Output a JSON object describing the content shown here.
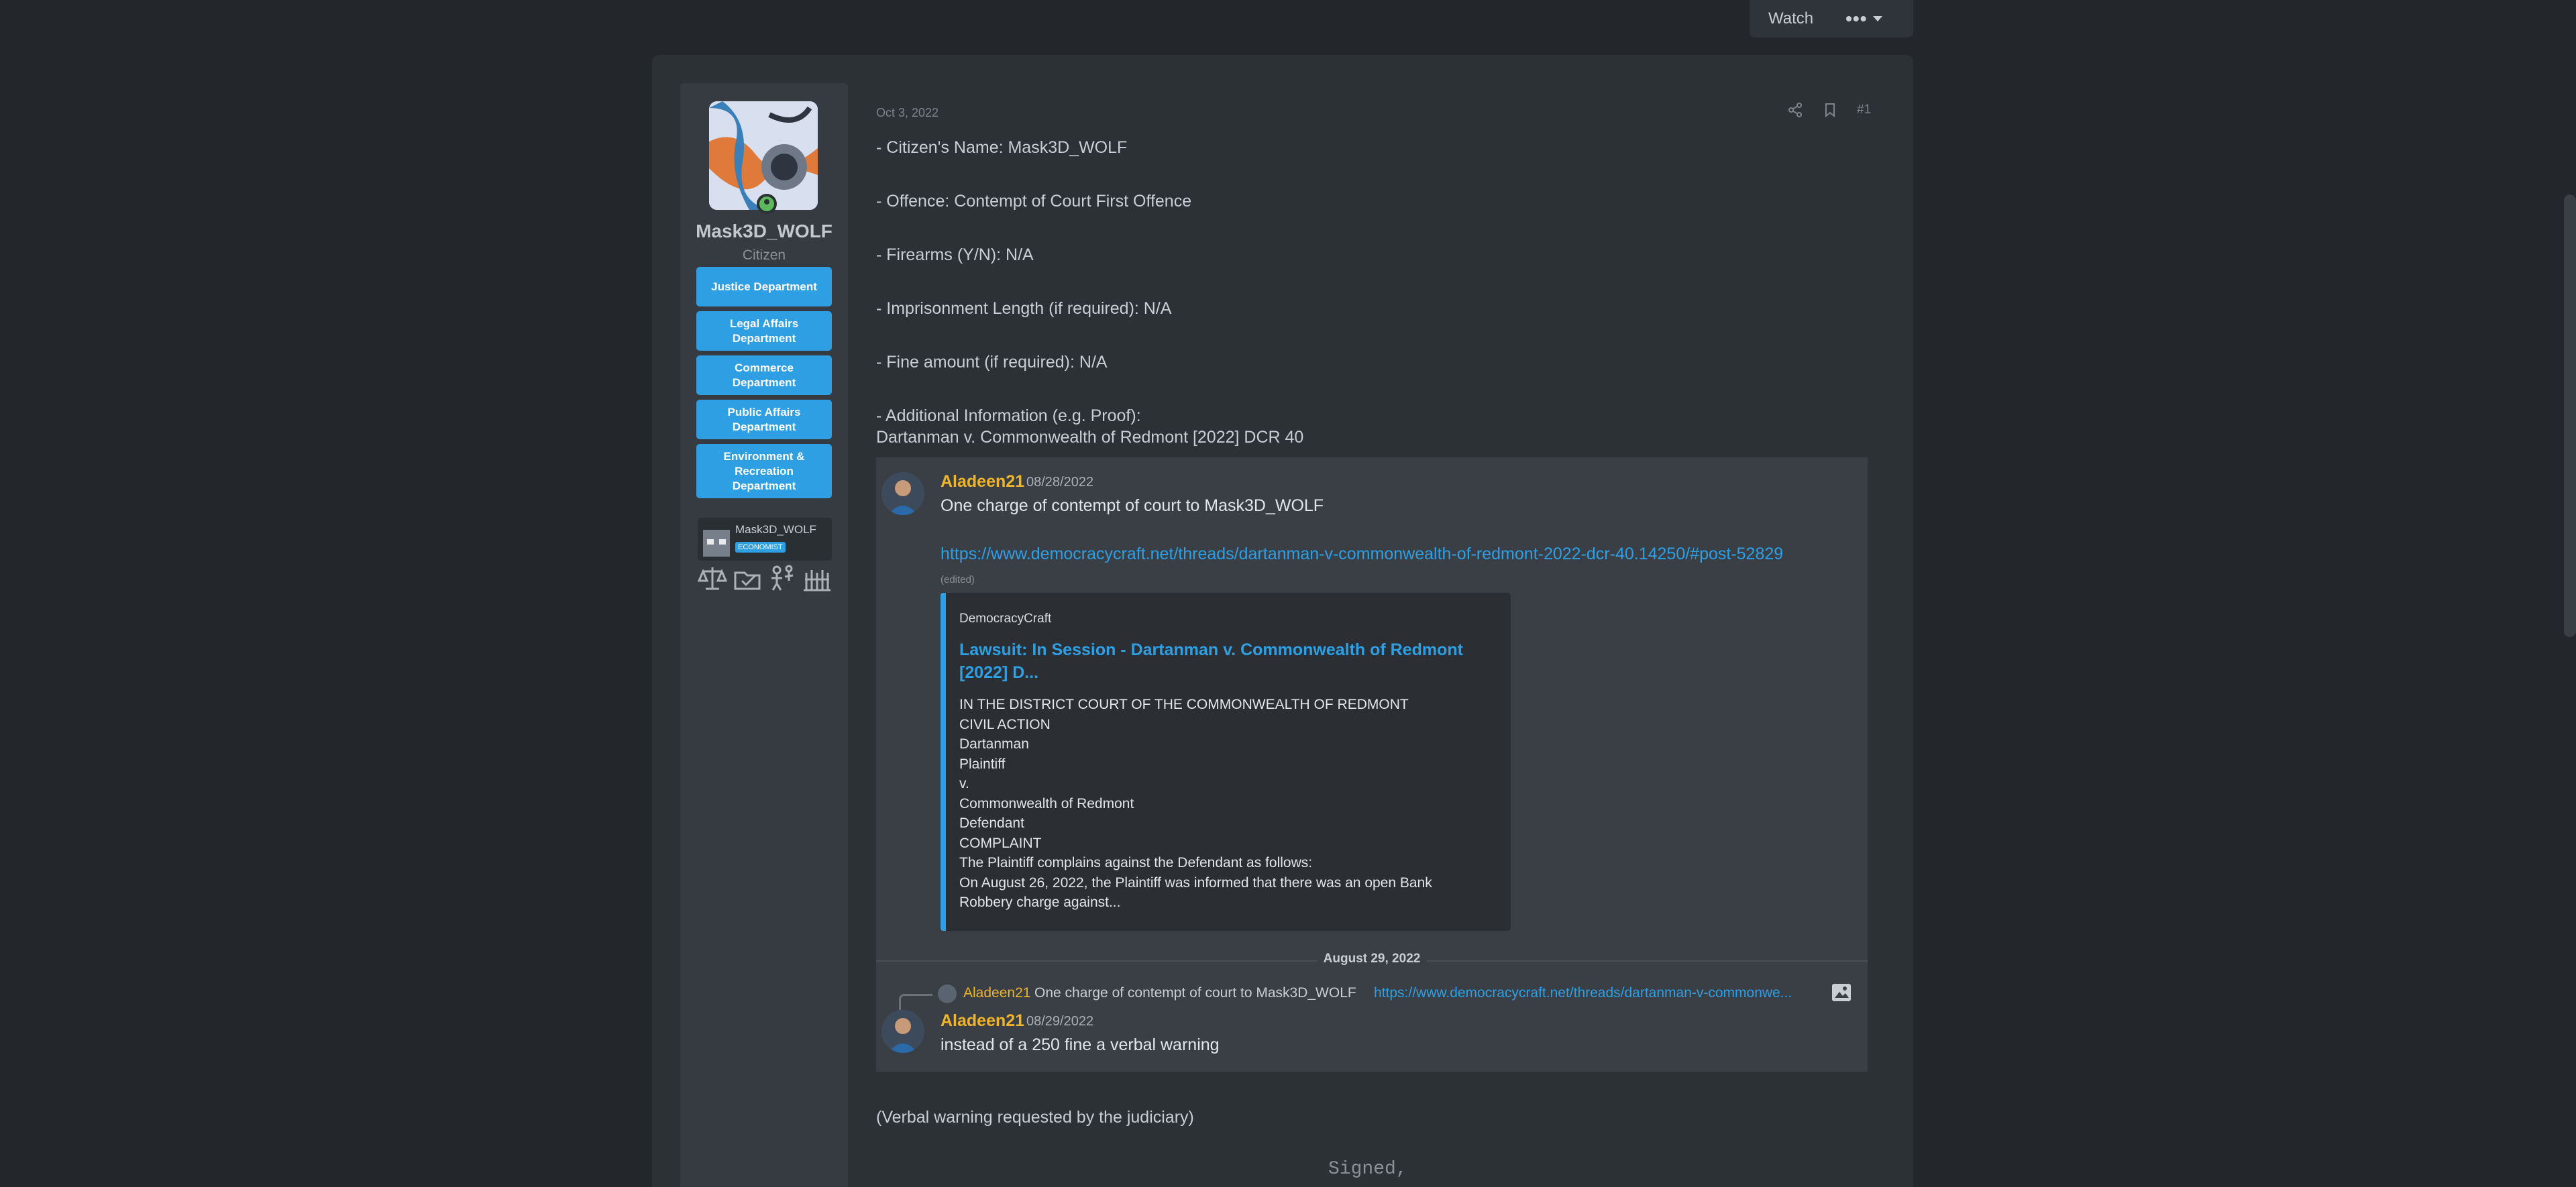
{
  "topbar": {
    "watch_label": "Watch",
    "more_label": "•••"
  },
  "user": {
    "name": "Mask3D_WOLF",
    "title": "Citizen",
    "departments": [
      "Justice Department",
      "Legal Affairs Department",
      "Commerce Department",
      "Public Affairs Department",
      "Environment & Recreation Department"
    ],
    "minecraft": {
      "name": "Mask3D_WOLF",
      "badge": "ECONOMIST"
    },
    "trophy_icons": [
      "scales-icon",
      "checkbox-folder-icon",
      "people-icon",
      "factory-icon"
    ],
    "status_color": "#5cb85c"
  },
  "post": {
    "date": "Oct 3, 2022",
    "number": "#1",
    "lines": [
      "- Citizen's Name: Mask3D_WOLF",
      "- Offence: Contempt of Court First Offence",
      "- Firearms (Y/N): N/A",
      "- Imprisonment Length (if required): N/A",
      "- Fine amount (if required): N/A",
      "- Additional Information (e.g. Proof):"
    ],
    "case_line": "Dartanman v. Commonwealth of Redmont [2022] DCR 40",
    "after_quote": "(Verbal warning requested by the judiciary)",
    "signed": "Signed,"
  },
  "quote": {
    "msg1": {
      "author": "Aladeen21",
      "date": "08/28/2022",
      "text": "One charge of contempt of court to Mask3D_WOLF",
      "link": "https://www.democracycraft.net/threads/dartanman-v-commonwealth-of-redmont-2022-dcr-40.14250/#post-52829",
      "edited": "(edited)"
    },
    "embed": {
      "site": "DemocracyCraft",
      "title": "Lawsuit: In Session - Dartanman v. Commonwealth of Redmont [2022] D...",
      "body": [
        "IN THE DISTRICT COURT OF THE COMMONWEALTH OF REDMONT",
        "CIVIL ACTION",
        "Dartanman",
        "Plaintiff",
        "v.",
        "Commonwealth of Redmont",
        "Defendant",
        "COMPLAINT",
        "The Plaintiff complains against the Defendant as follows:",
        "On August 26, 2022, the Plaintiff was informed that there was an open Bank",
        "Robbery charge against..."
      ]
    },
    "divider": "August 29, 2022",
    "reply": {
      "author": "Aladeen21",
      "text": "One charge of contempt of court to Mask3D_WOLF",
      "link": "https://www.democracycraft.net/threads/dartanman-v-commonwe..."
    },
    "msg2": {
      "author": "Aladeen21",
      "date": "08/29/2022",
      "text": "instead of a 250 fine a verbal warning"
    },
    "colors": {
      "author": "#f0b429",
      "link": "#2f9fe4"
    }
  }
}
